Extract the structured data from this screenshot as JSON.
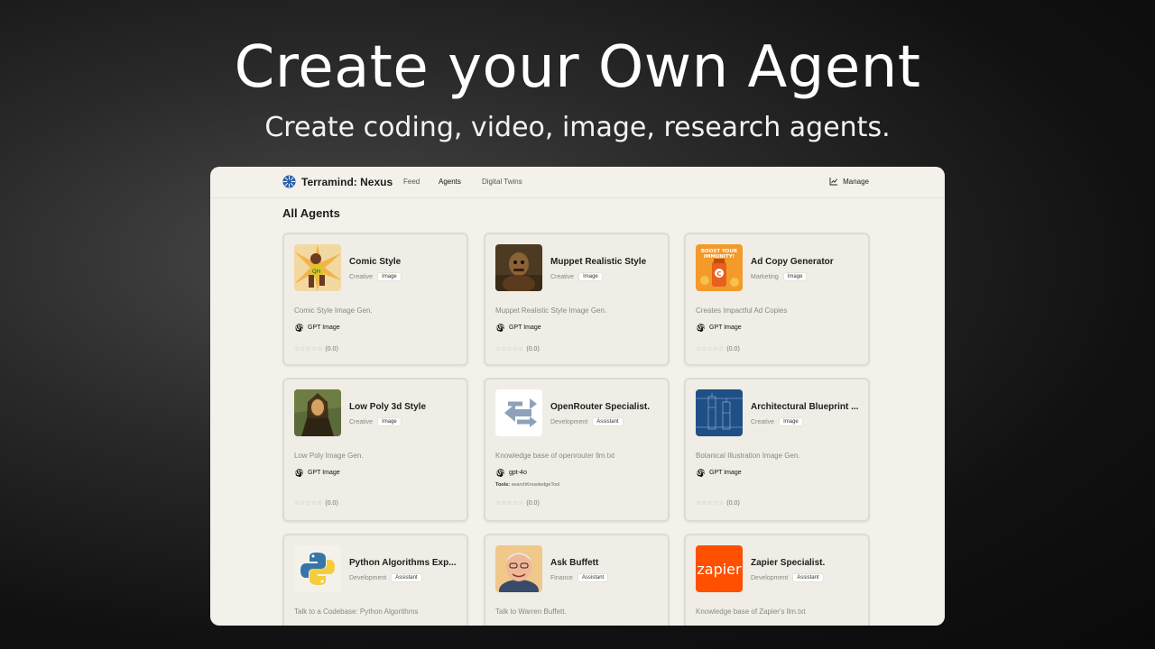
{
  "hero": {
    "title": "Create your Own Agent",
    "subtitle": "Create coding, video, image, research agents."
  },
  "nav": {
    "brand": "Terramind: Nexus",
    "links": [
      "Feed",
      "Agents",
      "Digital Twins"
    ],
    "manage": "Manage"
  },
  "section_title": "All Agents",
  "cards": [
    {
      "name": "Comic Style",
      "category": "Creative",
      "tag": "Image",
      "description": "Comic Style Image Gen.",
      "model": "GPT Image",
      "rating": "(0.0)",
      "stars": "☆☆☆☆☆",
      "thumb": "comic"
    },
    {
      "name": "Muppet Realistic Style",
      "category": "Creative",
      "tag": "Image",
      "description": "Muppet Realistic Style Image Gen.",
      "model": "GPT Image",
      "rating": "(0.0)",
      "stars": "☆☆☆☆☆",
      "thumb": "muppet"
    },
    {
      "name": "Ad Copy Generator",
      "category": "Marketing",
      "tag": "Image",
      "description": "Creates Impactful Ad Copies",
      "model": "GPT Image",
      "rating": "(0.0)",
      "stars": "☆☆☆☆☆",
      "thumb": "adcopy"
    },
    {
      "name": "Low Poly 3d Style",
      "category": "Creative",
      "tag": "Image",
      "description": "Low Poly Image Gen.",
      "model": "GPT Image",
      "rating": "(0.0)",
      "stars": "☆☆☆☆☆",
      "thumb": "lowpoly"
    },
    {
      "name": "OpenRouter Specialist.",
      "category": "Development",
      "tag": "Assistant",
      "description": "Knowledge base of openrouter llm.txt",
      "model": "gpt-4o",
      "tools_label": "Tools:",
      "tools_value": "searchKnowledgeTool",
      "rating": "(0.0)",
      "stars": "☆☆☆☆☆",
      "thumb": "openrouter"
    },
    {
      "name": "Architectural Blueprint ...",
      "category": "Creative",
      "tag": "Image",
      "description": "Botanical Illustration Image Gen.",
      "model": "GPT Image",
      "rating": "(0.0)",
      "stars": "☆☆☆☆☆",
      "thumb": "blueprint"
    },
    {
      "name": "Python Algorithms Exp...",
      "category": "Development",
      "tag": "Assistant",
      "description": "Talk to a Codebase: Python Algorithms",
      "thumb": "python"
    },
    {
      "name": "Ask Buffett",
      "category": "Finance",
      "tag": "Assistant",
      "description": "Talk to Warren Buffett.",
      "thumb": "buffett"
    },
    {
      "name": "Zapier Specialist.",
      "category": "Development",
      "tag": "Assistant",
      "description": "Knowledge base of Zapier's llm.txt",
      "thumb": "zapier",
      "thumb_text": "zapier"
    }
  ],
  "colors": {
    "accent_zapier": "#ff4f00",
    "panel_bg": "#f3f1ea"
  }
}
